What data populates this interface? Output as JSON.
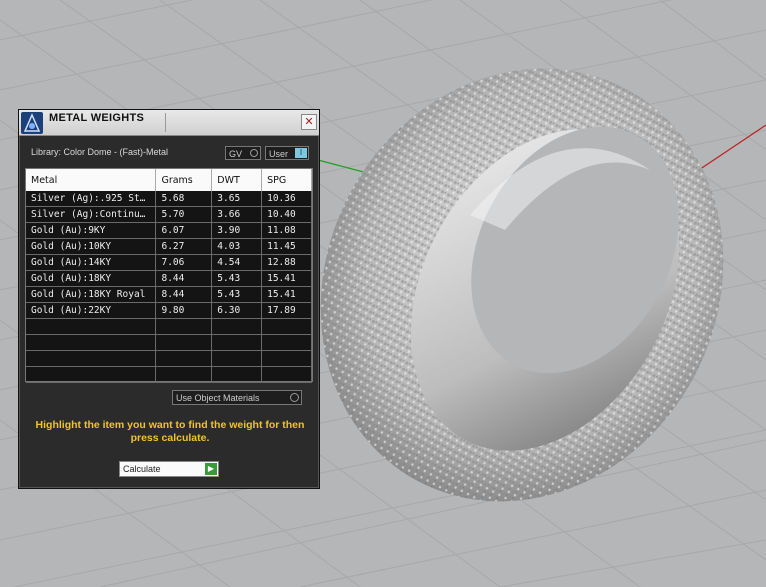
{
  "window": {
    "title": "METAL WEIGHTS",
    "close_glyph": "✕"
  },
  "library_label": "Library: Color Dome - (Fast)-Metal",
  "gv_toggle_label": "GV",
  "user_toggle_label": "User",
  "user_toggle_mark": "I",
  "table": {
    "headers": [
      "Metal",
      "Grams",
      "DWT",
      "SPG"
    ],
    "rows": [
      {
        "metal": "Silver (Ag):.925 St...",
        "grams": "5.68",
        "dwt": "3.65",
        "spg": "10.36"
      },
      {
        "metal": "Silver (Ag):Continu...",
        "grams": "5.70",
        "dwt": "3.66",
        "spg": "10.40"
      },
      {
        "metal": "Gold (Au):9KY",
        "grams": "6.07",
        "dwt": "3.90",
        "spg": "11.08"
      },
      {
        "metal": "Gold (Au):10KY",
        "grams": "6.27",
        "dwt": "4.03",
        "spg": "11.45"
      },
      {
        "metal": "Gold (Au):14KY",
        "grams": "7.06",
        "dwt": "4.54",
        "spg": "12.88"
      },
      {
        "metal": "Gold (Au):18KY",
        "grams": "8.44",
        "dwt": "5.43",
        "spg": "15.41"
      },
      {
        "metal": "Gold (Au):18KY Royal",
        "grams": "8.44",
        "dwt": "5.43",
        "spg": "15.41"
      },
      {
        "metal": "Gold (Au):22KY",
        "grams": "9.80",
        "dwt": "6.30",
        "spg": "17.89"
      }
    ]
  },
  "use_object_materials_label": "Use Object Materials",
  "hint_text": "Highlight the item you want to find the weight for then press calculate.",
  "calculate_label": "Calculate",
  "colors": {
    "hint": "#f2c32a",
    "panel_bg": "#2b2b2b",
    "axis_x": "#c02020",
    "axis_y": "#20a020"
  }
}
